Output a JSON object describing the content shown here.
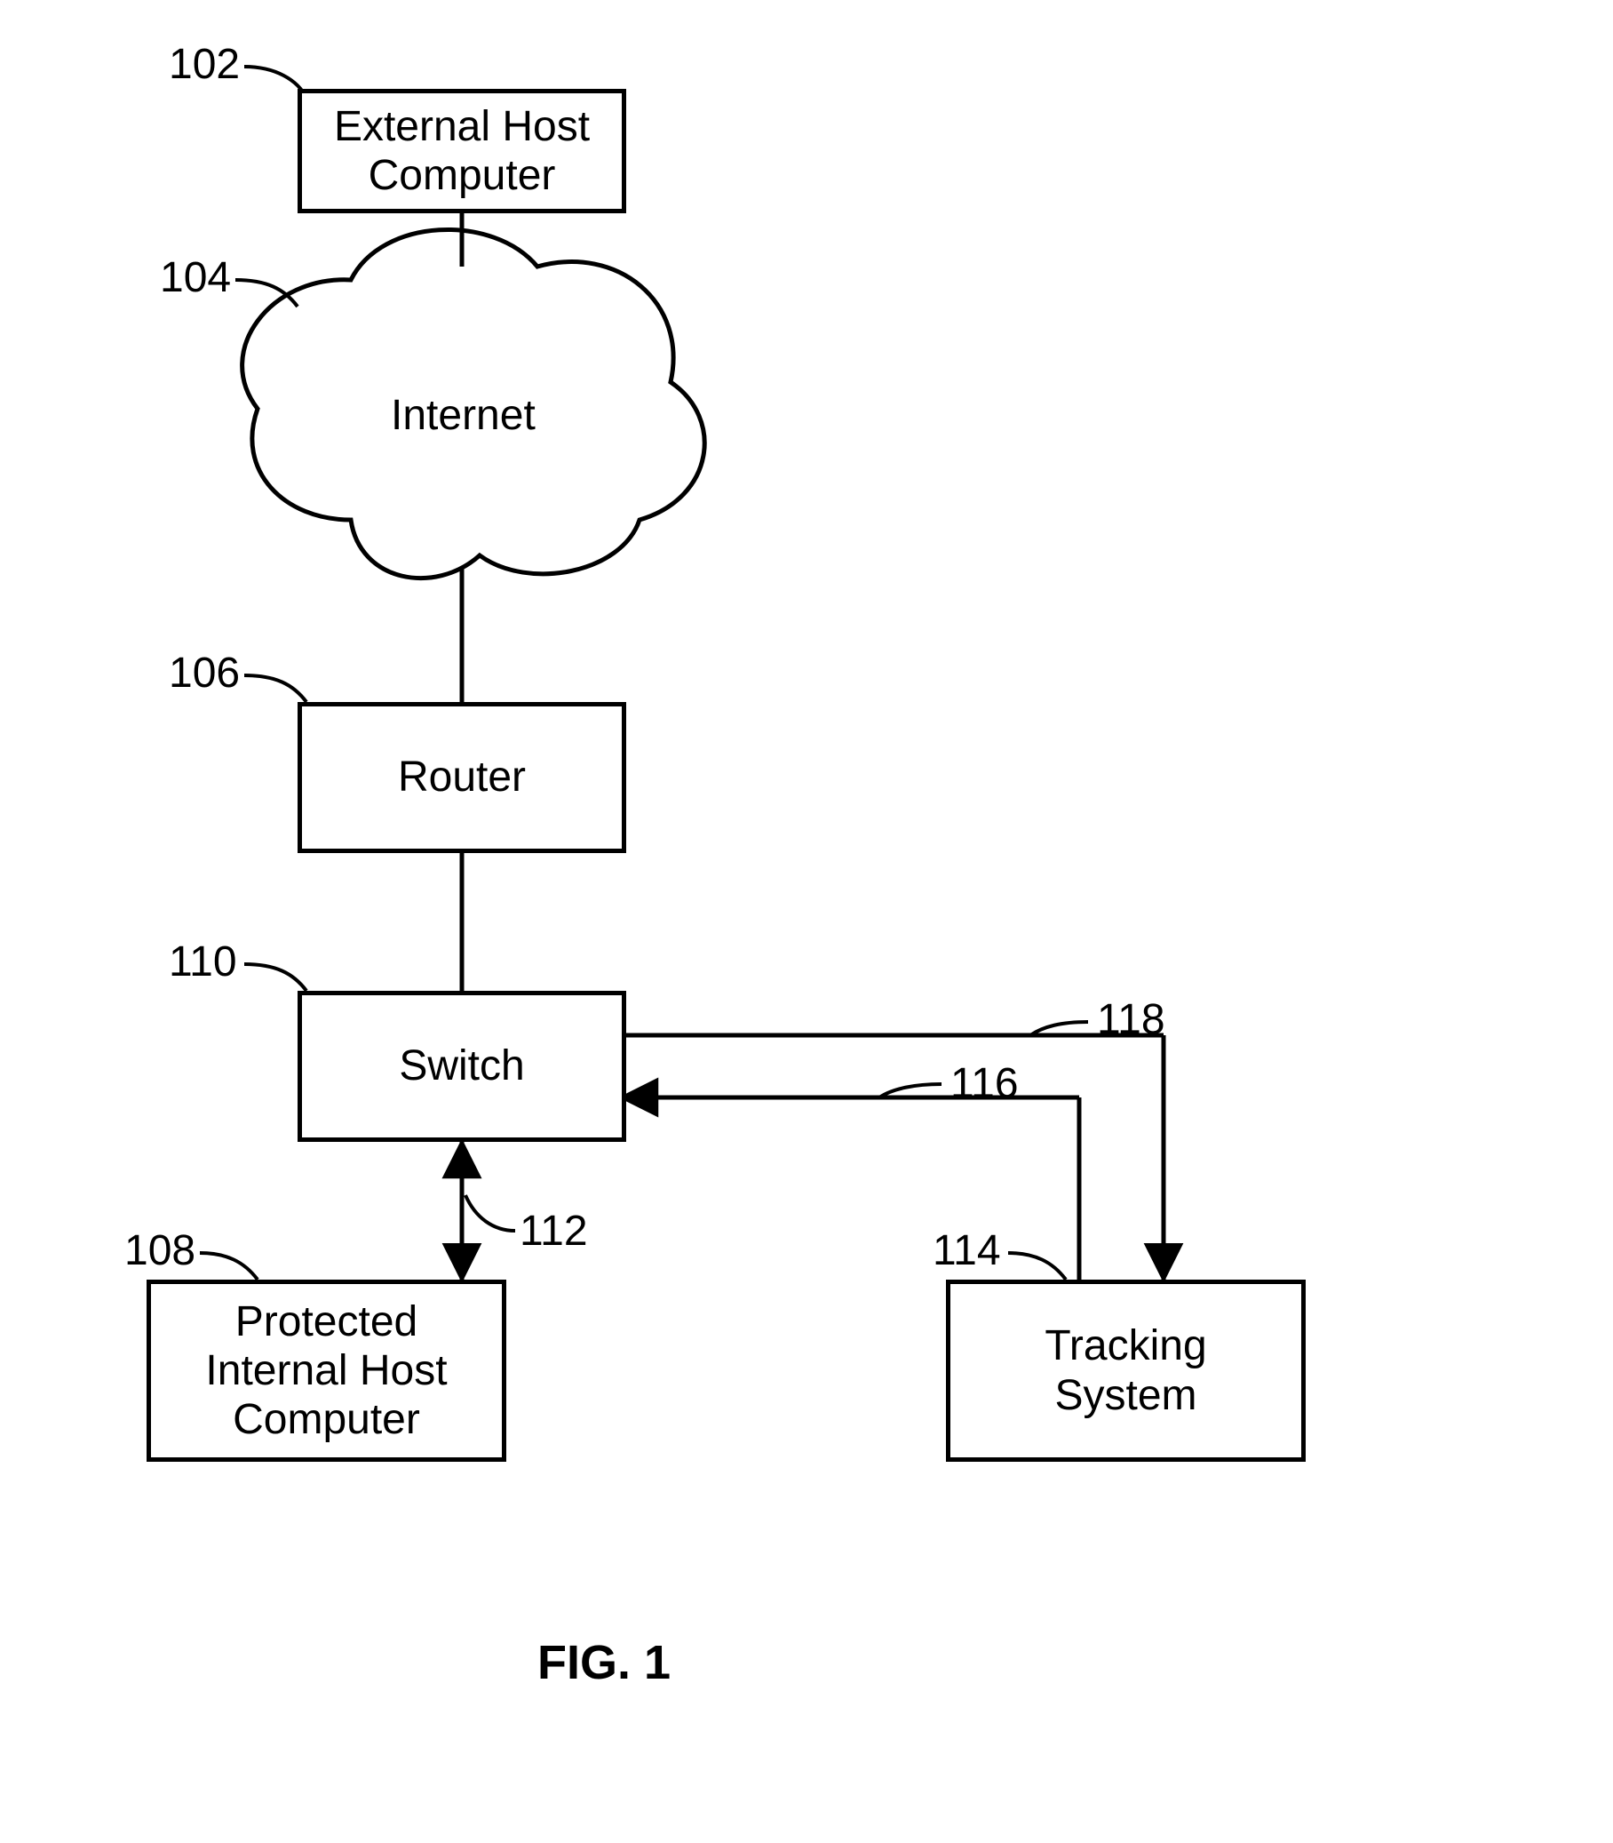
{
  "figure_caption": "FIG. 1",
  "nodes": {
    "external_host": {
      "label": "External Host\nComputer",
      "ref": "102"
    },
    "internet": {
      "label": "Internet",
      "ref": "104"
    },
    "router": {
      "label": "Router",
      "ref": "106"
    },
    "switch": {
      "label": "Switch",
      "ref": "110"
    },
    "protected": {
      "label": "Protected\nInternal Host\nComputer",
      "ref": "108"
    },
    "tracking": {
      "label": "Tracking\nSystem",
      "ref": "114"
    }
  },
  "edges": {
    "switch_protected": {
      "ref": "112"
    },
    "tracking_to_switch": {
      "ref": "116"
    },
    "switch_to_tracking": {
      "ref": "118"
    }
  }
}
